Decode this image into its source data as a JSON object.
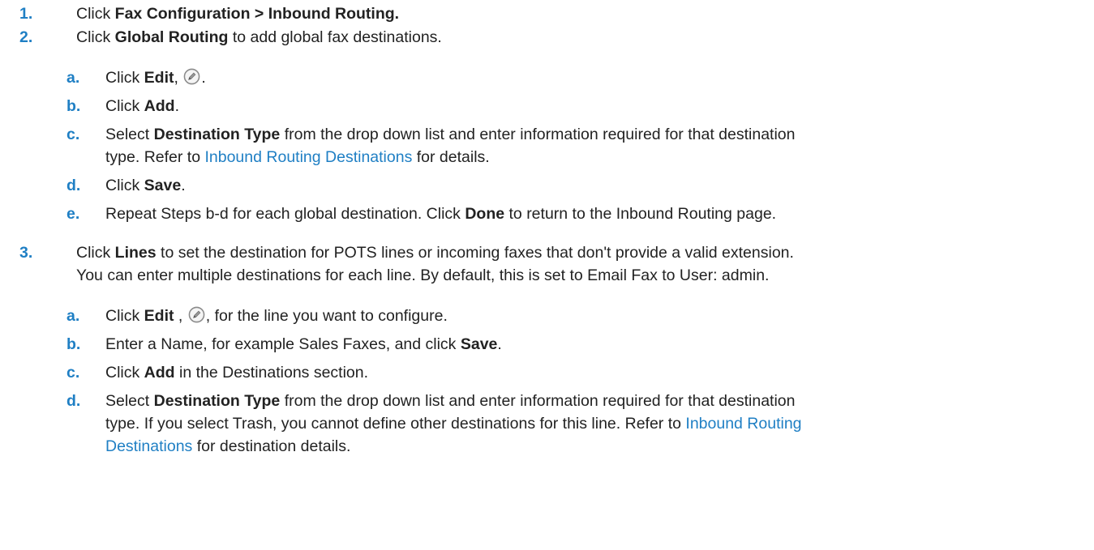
{
  "steps": [
    {
      "number": "1.",
      "text_before": "Click ",
      "bold": "Fax Configuration > Inbound Routing."
    },
    {
      "number": "2.",
      "text_before": "Click ",
      "bold": "Global Routing",
      "text_after": " to add global fax destinations.",
      "substeps": {
        "a": {
          "letter": "a.",
          "t1": "Click ",
          "b1": "Edit",
          "t2": ", ",
          "t3": "."
        },
        "b": {
          "letter": "b.",
          "t1": "Click ",
          "b1": "Add",
          "t2": "."
        },
        "c": {
          "letter": "c.",
          "t1": "Select ",
          "b1": "Destination Type",
          "t2": " from the drop down list and enter information required for that destination",
          "line2_before": "type. Refer to ",
          "link": "Inbound Routing Destinations",
          "line2_after": " for details."
        },
        "d": {
          "letter": "d.",
          "t1": "Click ",
          "b1": "Save",
          "t2": "."
        },
        "e": {
          "letter": "e.",
          "t1": "Repeat Steps b-d for each global destination. Click ",
          "b1": "Done",
          "t2": " to return to the Inbound Routing page."
        }
      }
    },
    {
      "number": "3.",
      "text_before": "Click ",
      "bold": "Lines",
      "text_after": " to set the destination for POTS lines or incoming faxes that don't provide a valid extension.",
      "line2": "You can enter multiple destinations for each line. By default, this is set to Email Fax to User: admin.",
      "substeps": {
        "a": {
          "letter": "a.",
          "t1": "Click ",
          "b1": "Edit",
          "t2": " , ",
          "t3": ", for the line you want to configure."
        },
        "b": {
          "letter": "b.",
          "t1": "Enter a Name, for example Sales Faxes, and click ",
          "b1": "Save",
          "t2": "."
        },
        "c": {
          "letter": "c.",
          "t1": "Click ",
          "b1": "Add",
          "t2": " in the Destinations section."
        },
        "d": {
          "letter": "d.",
          "t1": "Select ",
          "b1": "Destination Type",
          "t2": " from the drop down list and enter information required for that destination",
          "line2_before": "type. If you select Trash, you cannot define other destinations for this line. Refer to ",
          "link_part1": "Inbound Routing",
          "link_part2": "Destinations",
          "line3_after": " for destination details."
        }
      }
    }
  ],
  "icons": {
    "edit": "edit-pencil-circle-icon"
  },
  "colors": {
    "accent": "#1f7fc4",
    "text": "#222222"
  }
}
